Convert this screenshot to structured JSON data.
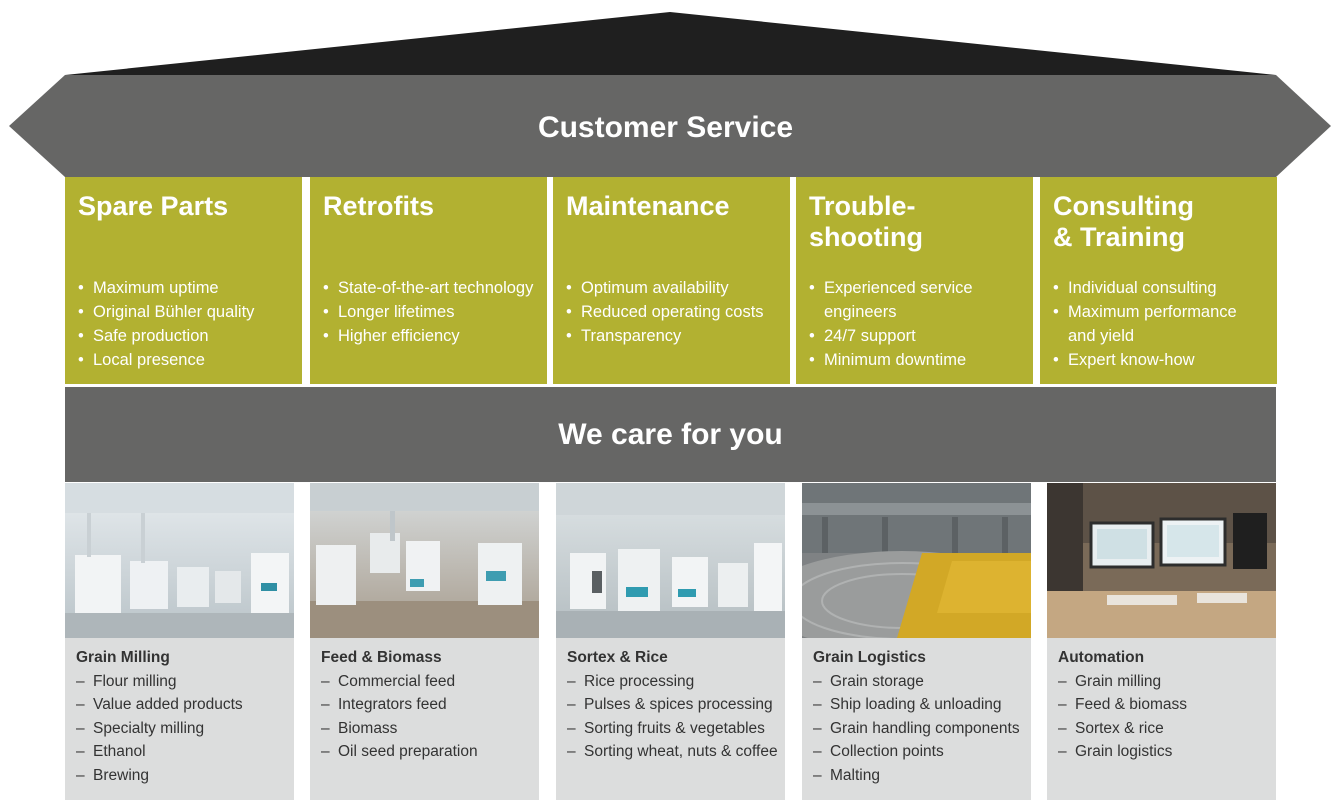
{
  "roof": {
    "title": "Customer Service"
  },
  "pillars": [
    {
      "title": "Spare Parts",
      "items": [
        "Maximum uptime",
        "Original Bühler quality",
        "Safe production",
        "Local presence"
      ]
    },
    {
      "title": "Retrofits",
      "items": [
        "State-of-the-art technology",
        "Longer lifetimes",
        "Higher efficiency"
      ]
    },
    {
      "title": "Maintenance",
      "items": [
        "Optimum availability",
        "Reduced operating costs",
        "Transparency"
      ]
    },
    {
      "title": "Trouble-\nshooting",
      "items": [
        "Experienced service engineers",
        "24/7 support",
        "Minimum downtime"
      ]
    },
    {
      "title": "Consulting\n& Training",
      "items": [
        "Individual consulting",
        "Maximum performance and yield",
        "Expert know-how"
      ]
    }
  ],
  "band": {
    "title": "We care for you"
  },
  "segments": [
    {
      "title": "Grain Milling",
      "photo": "mill-photo",
      "items": [
        "Flour milling",
        "Value added products",
        "Specialty milling",
        "Ethanol",
        "Brewing"
      ]
    },
    {
      "title": "Feed & Biomass",
      "photo": "feed-photo",
      "items": [
        "Commercial feed",
        "Integrators feed",
        "Biomass",
        "Oil seed preparation"
      ]
    },
    {
      "title": "Sortex & Rice",
      "photo": "sortex-photo",
      "items": [
        "Rice processing",
        "Pulses & spices processing",
        "Sorting fruits & vegetables",
        "Sorting wheat, nuts & coffee"
      ]
    },
    {
      "title": "Grain Logistics",
      "photo": "silo-photo",
      "items": [
        "Grain storage",
        "Ship loading & unloading",
        "Grain handling components",
        "Collection points",
        "Malting"
      ]
    },
    {
      "title": "Automation",
      "photo": "control-room-photo",
      "items": [
        "Grain milling",
        "Feed & biomass",
        "Sortex & rice",
        "Grain logistics"
      ]
    }
  ],
  "colors": {
    "roof_dark": "#1f1f1f",
    "roof_band": "#666665",
    "pillar": "#b2b131",
    "band": "#666665",
    "segment_bg": "#dcdddd"
  }
}
